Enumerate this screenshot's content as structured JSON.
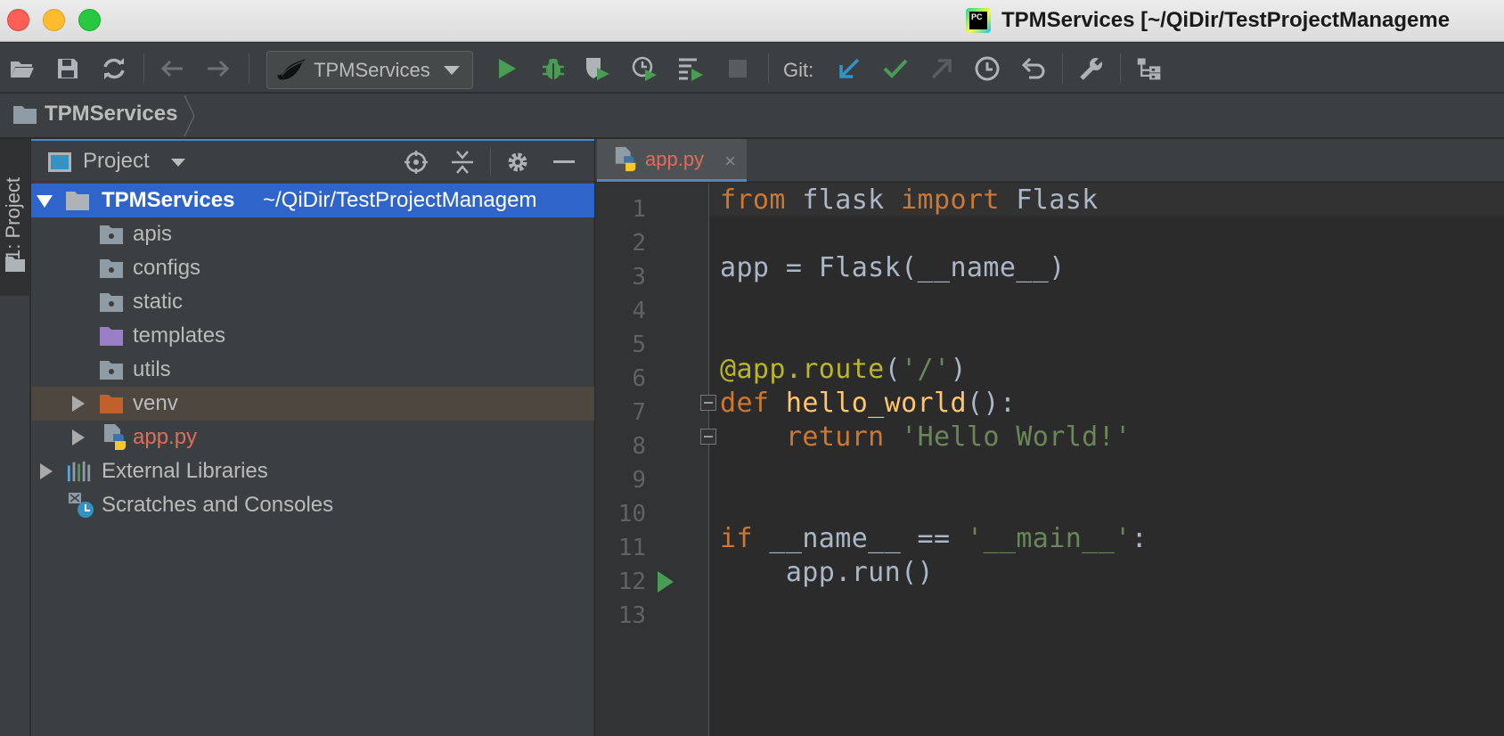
{
  "window": {
    "title": "TPMServices [~/QiDir/TestProjectManageme"
  },
  "toolbar": {
    "run_config": "TPMServices",
    "git_label": "Git:"
  },
  "breadcrumb": {
    "project": "TPMServices"
  },
  "stripe": {
    "tab_label": "1: Project"
  },
  "project_panel": {
    "title": "Project",
    "root": {
      "name": "TPMServices",
      "path": "~/QiDir/TestProjectManagem"
    },
    "items": [
      {
        "label": "apis"
      },
      {
        "label": "configs"
      },
      {
        "label": "static"
      },
      {
        "label": "templates"
      },
      {
        "label": "utils"
      },
      {
        "label": "venv"
      },
      {
        "label": "app.py"
      },
      {
        "label": "External Libraries"
      },
      {
        "label": "Scratches and Consoles"
      }
    ]
  },
  "editor": {
    "tab_label": "app.py",
    "tab_close": "×",
    "line_numbers": [
      "1",
      "2",
      "3",
      "4",
      "5",
      "6",
      "7",
      "8",
      "9",
      "10",
      "11",
      "12",
      "13"
    ],
    "code": {
      "l1_kw1": "from",
      "l1_t1": " flask ",
      "l1_kw2": "import",
      "l1_t2": " Flask",
      "l3": "app = Flask(__name__)",
      "l6_dec": "@app.route",
      "l6_t1": "(",
      "l6_str": "'/'",
      "l6_t2": ")",
      "l7_kw": "def",
      "l7_fn": " hello_world",
      "l7_t": "():",
      "l8_indent": "    ",
      "l8_kw": "return",
      "l8_str": " 'Hello World!'",
      "l11_kw": "if",
      "l11_t": " __name__ == ",
      "l11_str": "'__main__'",
      "l11_t2": ":",
      "l12": "    app.run()"
    }
  },
  "colors": {
    "keyword": "#cc7832",
    "string": "#6a8759",
    "function": "#ffc66d",
    "decorator": "#bbb529",
    "selection": "#2f65ca"
  }
}
